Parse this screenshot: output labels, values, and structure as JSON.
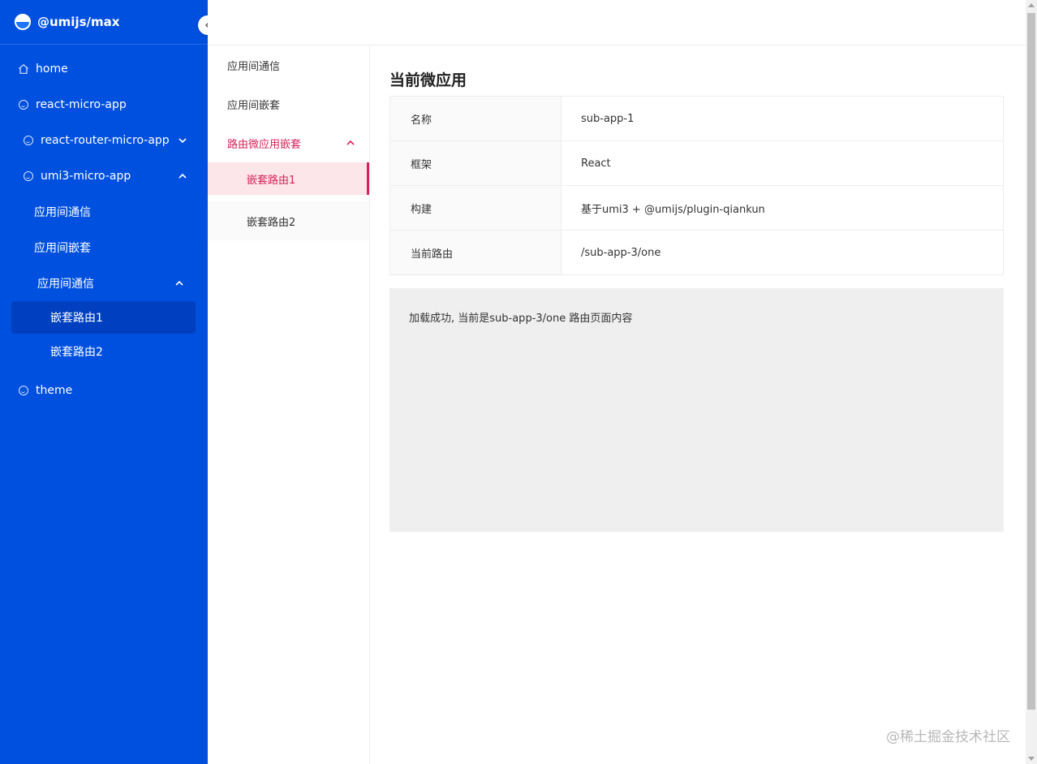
{
  "brand": {
    "title": "@umijs/max"
  },
  "collapse_icon": "chevron-left-icon",
  "sidebar": {
    "items": [
      {
        "label": "home",
        "icon": "home-icon"
      },
      {
        "label": "react-micro-app",
        "icon": "smile-icon"
      },
      {
        "label": "react-router-micro-app",
        "icon": "smile-icon",
        "arrow": "chevron-down-icon"
      },
      {
        "label": "umi3-micro-app",
        "icon": "smile-icon",
        "arrow": "chevron-up-icon"
      },
      {
        "label": "应用间通信"
      },
      {
        "label": "应用间嵌套"
      },
      {
        "label": "应用间通信",
        "arrow": "chevron-up-icon"
      },
      {
        "label": "嵌套路由1",
        "selected": true
      },
      {
        "label": "嵌套路由2"
      },
      {
        "label": "theme",
        "icon": "smile-icon"
      }
    ]
  },
  "submenu": {
    "items": [
      {
        "label": "应用间通信"
      },
      {
        "label": "应用间嵌套"
      },
      {
        "label": "路由微应用嵌套",
        "open": true
      },
      {
        "label": "嵌套路由1",
        "selected": true
      },
      {
        "label": "嵌套路由2"
      }
    ]
  },
  "main": {
    "title": "当前微应用",
    "details": [
      {
        "key": "名称",
        "value": "sub-app-1"
      },
      {
        "key": "框架",
        "value": "React"
      },
      {
        "key": "构建",
        "value": "基于umi3 + @umijs/plugin-qiankun"
      },
      {
        "key": "当前路由",
        "value": "/sub-app-3/one"
      }
    ],
    "content_text": "加载成功, 当前是sub-app-3/one 路由页面内容"
  },
  "watermark": "@稀土掘金技术社区",
  "colors": {
    "sidebar_bg": "#0050df",
    "accent": "#d4235a"
  }
}
